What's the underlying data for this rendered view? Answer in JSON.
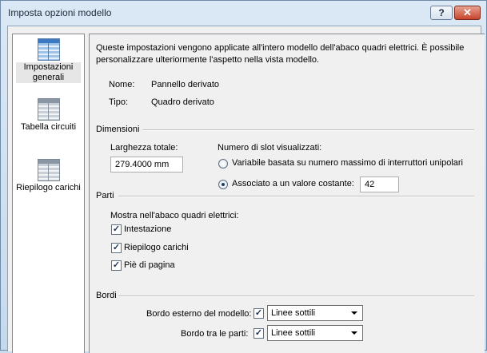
{
  "window": {
    "title": "Imposta opzioni modello",
    "help_label": "?",
    "close_label": "✕"
  },
  "nav": {
    "items": [
      {
        "label": "Impostazioni generali",
        "icon": "panel-schedule-icon",
        "selected": true
      },
      {
        "label": "Tabella circuiti",
        "icon": "circuit-table-icon",
        "selected": false
      },
      {
        "label": "Riepilogo carichi",
        "icon": "load-summary-icon",
        "selected": false
      }
    ]
  },
  "general": {
    "description": "Queste impostazioni vengono applicate all'intero modello dell'abaco quadri elettrici. È possibile personalizzare ulteriormente l'aspetto nella vista modello.",
    "name_label": "Nome:",
    "name_value": "Pannello derivato",
    "type_label": "Tipo:",
    "type_value": "Quadro derivato"
  },
  "dimensions": {
    "section_title": "Dimensioni",
    "width_label": "Larghezza totale:",
    "width_value": "279.4000 mm",
    "slots_label": "Numero di slot visualizzati:",
    "radio_variable_label": "Variabile basata su numero massimo di interruttori unipolari",
    "radio_constant_label": "Associato a un valore costante:",
    "constant_value": "42",
    "selected_option": "constant"
  },
  "parts": {
    "section_title": "Parti",
    "show_label": "Mostra nell'abaco quadri elettrici:",
    "items": [
      {
        "label": "Intestazione",
        "checked": true
      },
      {
        "label": "Riepilogo carichi",
        "checked": true
      },
      {
        "label": "Piè di pagina",
        "checked": true
      }
    ]
  },
  "borders": {
    "section_title": "Bordi",
    "outer_label": "Bordo esterno del modello:",
    "outer_checked": true,
    "outer_value": "Linee sottili",
    "between_label": "Bordo tra le parti:",
    "between_checked": true,
    "between_value": "Linee sottili"
  }
}
